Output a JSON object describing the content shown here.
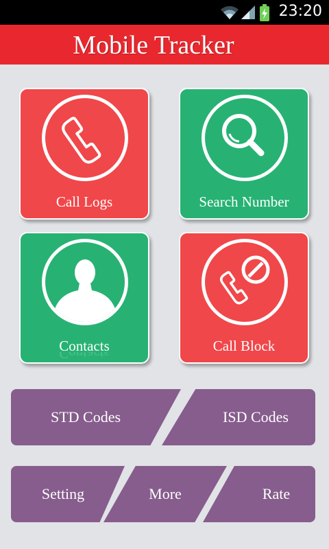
{
  "status_bar": {
    "time": "23:20",
    "icons": [
      "wifi-icon",
      "signal-icon",
      "battery-charging-icon"
    ]
  },
  "header": {
    "title": "Mobile Tracker"
  },
  "tiles": [
    {
      "label": "Call Logs",
      "icon": "phone-icon",
      "color": "#f0474a"
    },
    {
      "label": "Search Number",
      "icon": "search-icon",
      "color": "#27b274"
    },
    {
      "label": "Contacts",
      "icon": "person-icon",
      "color": "#27b274"
    },
    {
      "label": "Call Block",
      "icon": "call-block-icon",
      "color": "#f0474a"
    }
  ],
  "codes_bar": {
    "std_label": "STD Codes",
    "isd_label": "ISD Codes"
  },
  "bottom_bar": {
    "setting_label": "Setting",
    "more_label": "More",
    "rate_label": "Rate"
  },
  "colors": {
    "accent_red": "#e8282e",
    "tile_red": "#f0474a",
    "tile_green": "#27b274",
    "bar_purple": "#865d8c",
    "background": "#e1e3e6"
  }
}
